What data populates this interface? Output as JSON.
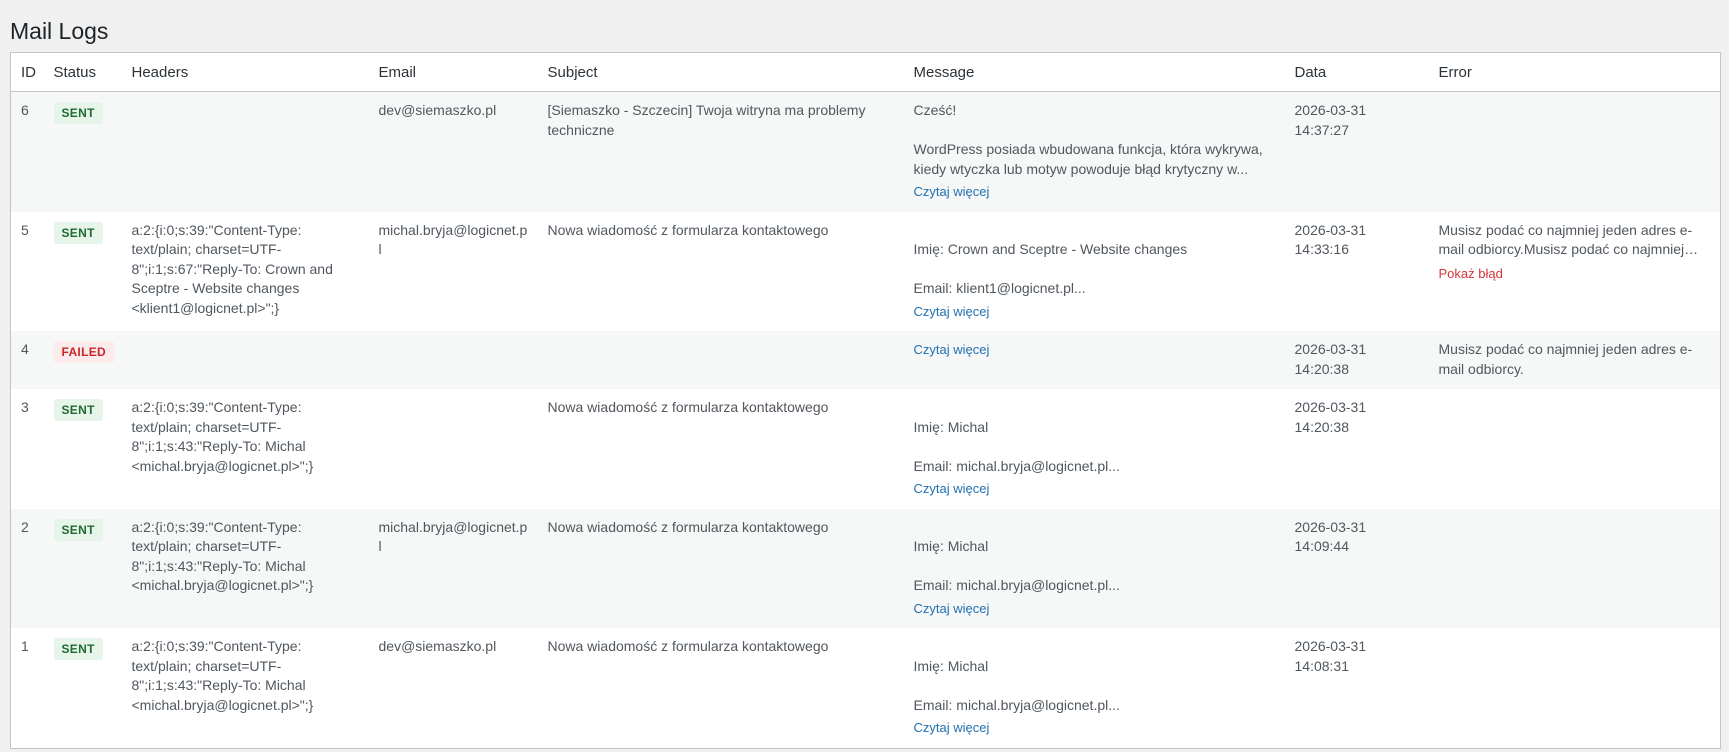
{
  "page": {
    "title": "Mail Logs"
  },
  "table": {
    "columns": [
      "ID",
      "Status",
      "Headers",
      "Email",
      "Subject",
      "Message",
      "Data",
      "Error"
    ],
    "read_more_label": "Czytaj więcej",
    "show_error_label": "Pokaż błąd",
    "rows": [
      {
        "id": "6",
        "status": "SENT",
        "headers": "",
        "email": "dev@siemaszko.pl",
        "subject": "[Siemaszko - Szczecin] Twoja witryna ma problemy techniczne",
        "message_first": "Cześć!",
        "message_rest": "WordPress posiada wbudowana funkcja, która wykrywa, kiedy wtyczka lub motyw powoduje błąd krytyczny w...",
        "date": "2026-03-31",
        "time": "14:37:27",
        "error": ""
      },
      {
        "id": "5",
        "status": "SENT",
        "headers": "a:2:{i:0;s:39:\"Content-Type: text/plain; charset=UTF-8\";i:1;s:67:\"Reply-To: Crown and Sceptre - Website changes <klient1@logicnet.pl>\";}",
        "email": "michal.bryja@logicnet.pl",
        "subject": "Nowa wiadomość z formularza kontaktowego",
        "message_first": "Imię: Crown and Sceptre - Website changes",
        "message_rest": "Email: klient1@logicnet.pl...",
        "date": "2026-03-31",
        "time": "14:33:16",
        "error": "Musisz podać co najmniej jeden adres e-mail odbiorcy.Musisz podać co najmniej jeden adres e-mail odbiorcy."
      },
      {
        "id": "4",
        "status": "FAILED",
        "headers": "",
        "email": "",
        "subject": "",
        "message_first": "",
        "message_rest": "",
        "date": "2026-03-31",
        "time": "14:20:38",
        "error": "Musisz podać co najmniej jeden adres e-mail odbiorcy."
      },
      {
        "id": "3",
        "status": "SENT",
        "headers": "a:2:{i:0;s:39:\"Content-Type: text/plain; charset=UTF-8\";i:1;s:43:\"Reply-To: Michal <michal.bryja@logicnet.pl>\";}",
        "email": "",
        "subject": "Nowa wiadomość z formularza kontaktowego",
        "message_first": "Imię: Michal",
        "message_rest": "Email: michal.bryja@logicnet.pl...",
        "date": "2026-03-31",
        "time": "14:20:38",
        "error": ""
      },
      {
        "id": "2",
        "status": "SENT",
        "headers": "a:2:{i:0;s:39:\"Content-Type: text/plain; charset=UTF-8\";i:1;s:43:\"Reply-To: Michal <michal.bryja@logicnet.pl>\";}",
        "email": "michal.bryja@logicnet.pl",
        "subject": "Nowa wiadomość z formularza kontaktowego",
        "message_first": "Imię: Michal",
        "message_rest": "Email: michal.bryja@logicnet.pl...",
        "date": "2026-03-31",
        "time": "14:09:44",
        "error": ""
      },
      {
        "id": "1",
        "status": "SENT",
        "headers": "a:2:{i:0;s:39:\"Content-Type: text/plain; charset=UTF-8\";i:1;s:43:\"Reply-To: Michal <michal.bryja@logicnet.pl>\";}",
        "email": "dev@siemaszko.pl",
        "subject": "Nowa wiadomość z formularza kontaktowego",
        "message_first": "Imię: Michal",
        "message_rest": "Email: michal.bryja@logicnet.pl...",
        "date": "2026-03-31",
        "time": "14:08:31",
        "error": ""
      }
    ]
  }
}
